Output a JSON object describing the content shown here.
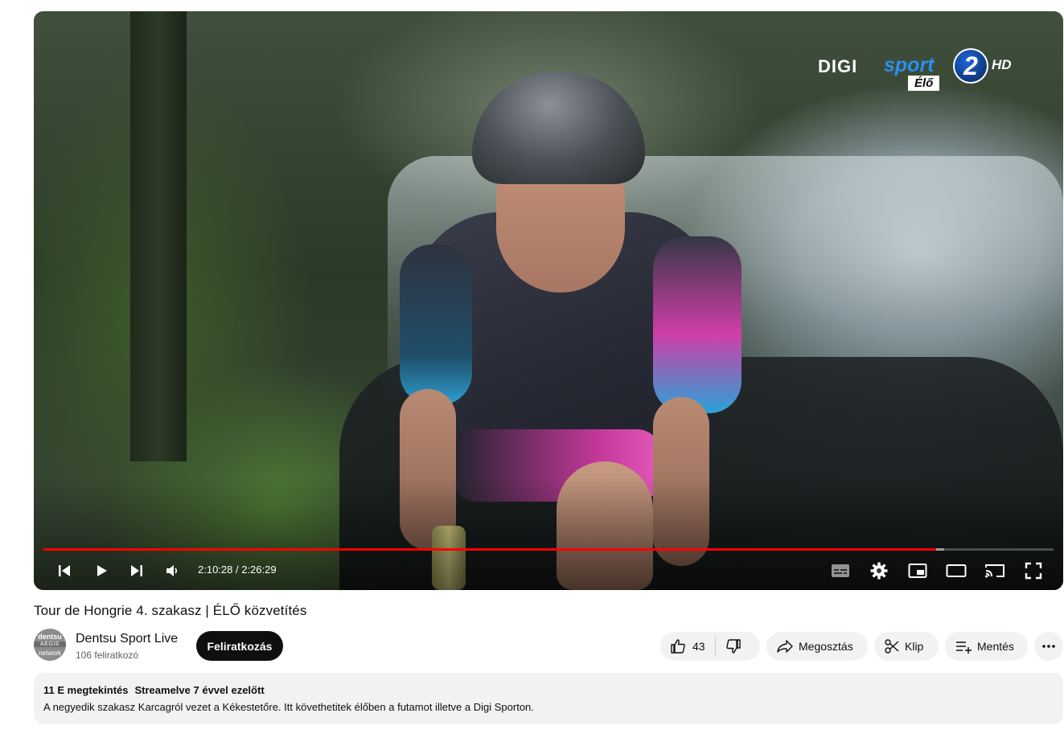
{
  "player": {
    "progress_fraction": 0.884,
    "buffer_fraction": 0.892,
    "time_current": "2:10:28",
    "time_total": "2:26:29",
    "time_separator": " / ",
    "overlay_logo": {
      "brand": "DIGI",
      "sport": "sport",
      "channel_number": "2",
      "quality": "HD",
      "live_label": "Élő"
    },
    "controls": {
      "previous": "previous-icon",
      "play": "play-icon",
      "next": "next-icon",
      "volume": "volume-icon",
      "subtitles": "subtitles-icon",
      "settings": "gear-icon",
      "miniplayer": "miniplayer-icon",
      "theater": "theater-mode-icon",
      "cast": "cast-icon",
      "fullscreen": "fullscreen-icon"
    },
    "colors": {
      "progress": "#ff0000",
      "logo_blue": "#2a8ff0"
    }
  },
  "video": {
    "title": "Tour de Hongrie 4. szakasz | ÉLŐ közvetítés"
  },
  "channel": {
    "name": "Dentsu Sport Live",
    "subscribers": "106 feliratkozó",
    "avatar_lines": [
      "dentsu",
      "AEGIS",
      "network"
    ],
    "subscribe_label": "Feliratkozás"
  },
  "actions": {
    "like_count": "43",
    "share_label": "Megosztás",
    "clip_label": "Klip",
    "save_label": "Mentés"
  },
  "description": {
    "views": "11 E megtekintés",
    "streamed": "Streamelve 7 évvel ezelőtt",
    "text": "A negyedik szakasz Karcagról vezet a Kékestetőre. Itt követhetitek élőben a futamot illetve a Digi Sporton."
  }
}
